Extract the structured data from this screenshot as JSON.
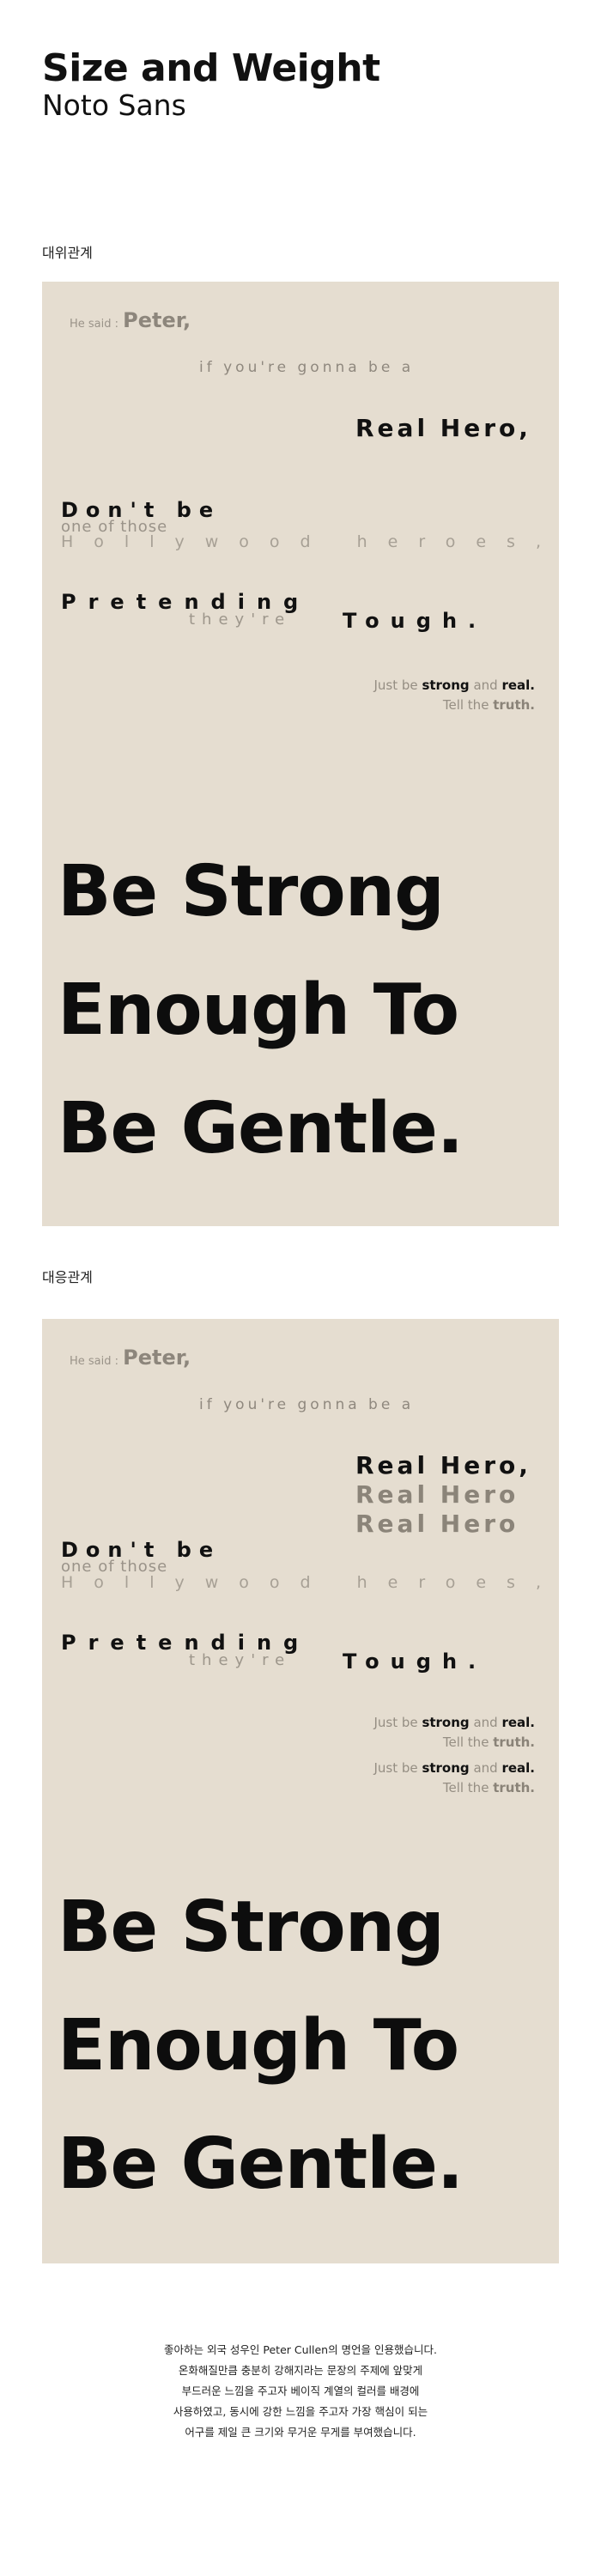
{
  "header": {
    "title": "Size and Weight",
    "subtitle": "Noto Sans"
  },
  "sections": [
    {
      "label": "대위관계"
    },
    {
      "label": "대응관계"
    }
  ],
  "poster": {
    "he_said_prefix": "He said :",
    "he_said_name": "Peter,",
    "gonna": "if you're gonna be a",
    "real_hero": "Real Hero,",
    "real_hero_echo": "Real Hero",
    "dont_be": "Don't be",
    "one_of_those": "one of those",
    "hollywood": "Hollywood heroes,",
    "pretending": "Pretending",
    "theyre": "they're",
    "tough": "Tough.",
    "just_be": "Just be",
    "strong": "strong",
    "and": "and",
    "real": "real.",
    "tell_the": "Tell the",
    "truth": "truth.",
    "big_line_1": "Be Strong",
    "big_line_2": "Enough To",
    "big_line_3": "Be Gentle."
  },
  "footer": {
    "lines": [
      "좋아하는 외국 성우인 Peter Cullen의 명언을 인용했습니다.",
      "온화해질만큼 충분히 강해지라는 문장의 주제에 앞맞게",
      "부드러운 느낌을 주고자 베이직 계열의 컬러를 배경에",
      "사용하였고, 동시에 강한 느낌을 주고자 가장 핵심이 되는",
      "어구를 제일 큰 크기와 무거운 무게를 부여했습니다."
    ]
  },
  "colors": {
    "panel_background": "#e5ddd0",
    "text_dark": "#111111",
    "text_muted": "#9a9389"
  }
}
